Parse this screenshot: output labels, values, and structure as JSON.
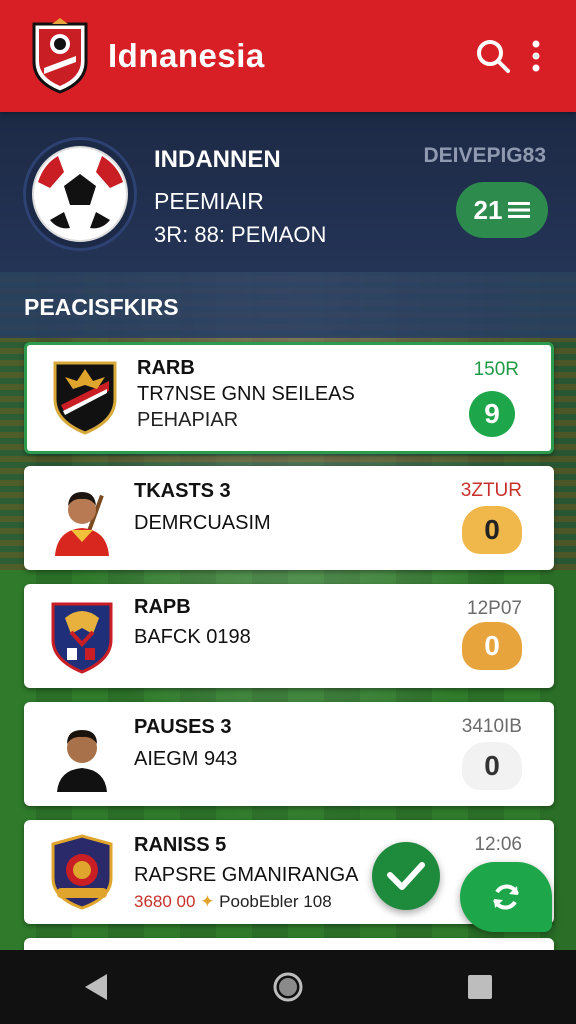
{
  "app": {
    "title": "Idnanesia"
  },
  "header": {
    "title": "INDANNEN",
    "subtitle": "PEEMIAIR",
    "meta": "3R: 88: PEMAON",
    "corner_text": "DEIVEPIG83",
    "score_value": "21"
  },
  "section": {
    "title": "PEACISFKIRS"
  },
  "matches": [
    {
      "line1": "RARB",
      "line2": "TR7NSE GNN SEILEAS",
      "line3": "PEHAPIAR",
      "time": "150R",
      "badge": "9",
      "time_color": "#1f9a46"
    },
    {
      "line1": "TKASTS 3",
      "line2": "DEMRCUASIM",
      "line3": "",
      "time": "3ZTUR",
      "badge": "0",
      "time_color": "#c8312b"
    },
    {
      "line1": "RAPB",
      "line2": "BAFCK 0198",
      "line3": "",
      "time": "12P07",
      "badge": "0",
      "time_color": "#6b6b6b"
    },
    {
      "line1": "PAUSES 3",
      "line2": "AIEGM 943",
      "line3": "",
      "time": "3410IB",
      "badge": "0",
      "time_color": "#6b6b6b"
    },
    {
      "line1": "RANISS 5",
      "line2": "RAPSRE GMANIRANGA",
      "line3_prefix": "3680 00",
      "line3": "PoobEbler 108",
      "time": "12:06",
      "badge": "",
      "time_color": "#6b6b6b"
    }
  ],
  "colors": {
    "appbar": "#d81f26",
    "accent_green": "#1ea64a",
    "accent_yellow": "#f0b84a"
  },
  "icons": {
    "search": "search-icon",
    "more": "more-vert-icon",
    "back": "back-icon",
    "home": "home-icon",
    "recents": "recents-icon"
  }
}
